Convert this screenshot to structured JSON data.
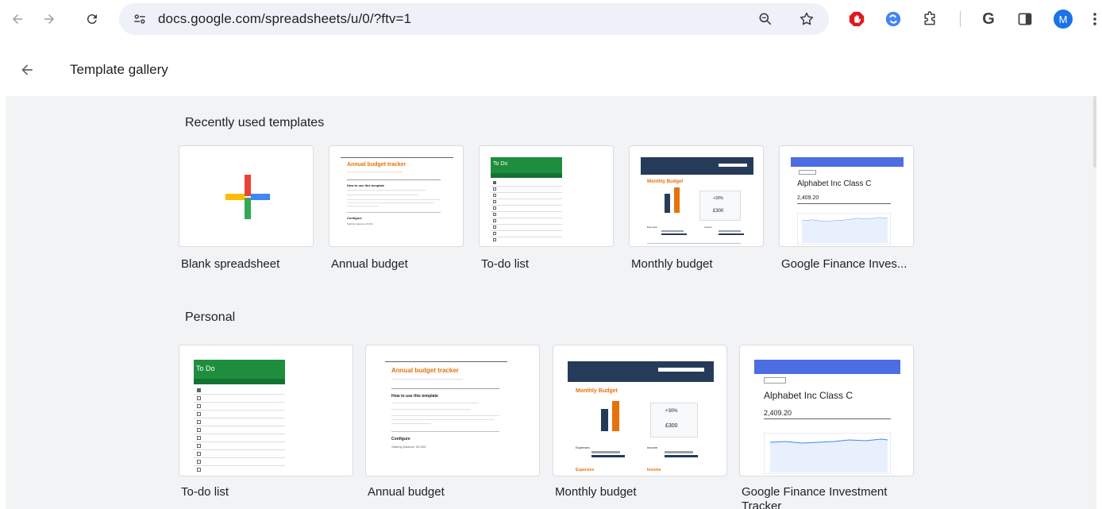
{
  "browser": {
    "url": "docs.google.com/spreadsheets/u/0/?ftv=1",
    "profile_initial": "M",
    "ext_g_label": "G"
  },
  "header": {
    "title": "Template gallery"
  },
  "sections": {
    "recent": {
      "title": "Recently used templates",
      "cards": [
        {
          "label": "Blank spreadsheet"
        },
        {
          "label": "Annual budget"
        },
        {
          "label": "To-do list"
        },
        {
          "label": "Monthly budget"
        },
        {
          "label": "Google Finance Inves..."
        }
      ]
    },
    "personal": {
      "title": "Personal",
      "cards": [
        {
          "label": "To-do list"
        },
        {
          "label": "Annual budget"
        },
        {
          "label": "Monthly budget"
        },
        {
          "label": "Google Finance Investment Tracker"
        }
      ]
    }
  },
  "thumbs": {
    "annual_title": "Annual budget tracker",
    "annual_how": "How to use this template",
    "annual_configure": "Configure",
    "annual_balance": "Starting balance:  £5,000",
    "todo_title": "To Do",
    "monthly_title": "Monthly Budget",
    "monthly_pct": "+30%",
    "monthly_amt": "£300",
    "monthly_expenses": "Expenses",
    "monthly_income": "Income",
    "gf_title": "Alphabet Inc Class C",
    "gf_price": "2,409.20"
  },
  "colors": {
    "accent_blue": "#1a73e8",
    "sheets_green": "#1e8e3e",
    "budget_orange": "#e8710a",
    "budget_navy": "#263b59",
    "gallery_bg": "#f1f3f4"
  }
}
